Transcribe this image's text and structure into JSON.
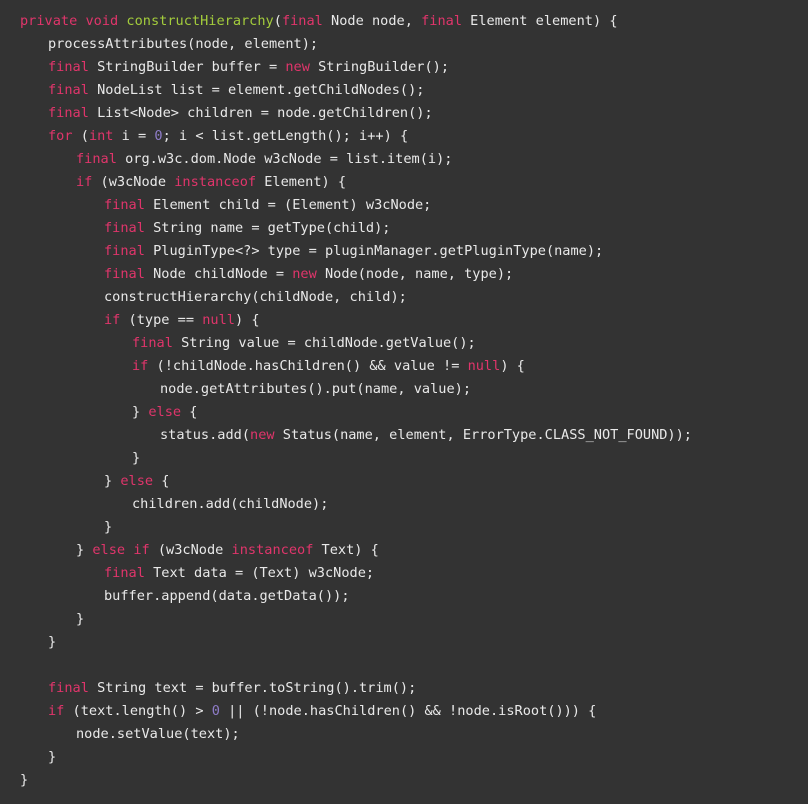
{
  "editor": {
    "background_color": "#333333",
    "default_text_color": "#e9e9e9",
    "keyword_color": "#e0356b",
    "method_color": "#a3cc3c",
    "number_color": "#8e7cc8",
    "language": "java",
    "font_size_px": 13.6,
    "line_height_px": 23
  },
  "code": {
    "lines": [
      {
        "indent": 0,
        "tokens": [
          {
            "t": "private",
            "c": "kw"
          },
          {
            "t": " ",
            "c": "pln"
          },
          {
            "t": "void",
            "c": "kw"
          },
          {
            "t": " ",
            "c": "pln"
          },
          {
            "t": "constructHierarchy",
            "c": "fn"
          },
          {
            "t": "(",
            "c": "pln"
          },
          {
            "t": "final",
            "c": "kw"
          },
          {
            "t": " Node node, ",
            "c": "pln"
          },
          {
            "t": "final",
            "c": "kw"
          },
          {
            "t": " Element element) {",
            "c": "pln"
          }
        ]
      },
      {
        "indent": 1,
        "tokens": [
          {
            "t": "processAttributes(node, element);",
            "c": "pln"
          }
        ]
      },
      {
        "indent": 1,
        "tokens": [
          {
            "t": "final",
            "c": "kw"
          },
          {
            "t": " StringBuilder buffer = ",
            "c": "pln"
          },
          {
            "t": "new",
            "c": "kw"
          },
          {
            "t": " StringBuilder();",
            "c": "pln"
          }
        ]
      },
      {
        "indent": 1,
        "tokens": [
          {
            "t": "final",
            "c": "kw"
          },
          {
            "t": " NodeList list = element.getChildNodes();",
            "c": "pln"
          }
        ]
      },
      {
        "indent": 1,
        "tokens": [
          {
            "t": "final",
            "c": "kw"
          },
          {
            "t": " List<Node> children = node.getChildren();",
            "c": "pln"
          }
        ]
      },
      {
        "indent": 1,
        "tokens": [
          {
            "t": "for",
            "c": "kw"
          },
          {
            "t": " (",
            "c": "pln"
          },
          {
            "t": "int",
            "c": "kw"
          },
          {
            "t": " i = ",
            "c": "pln"
          },
          {
            "t": "0",
            "c": "num"
          },
          {
            "t": "; i < list.getLength(); i++) {",
            "c": "pln"
          }
        ]
      },
      {
        "indent": 2,
        "tokens": [
          {
            "t": "final",
            "c": "kw"
          },
          {
            "t": " org.w3c.dom.Node w3cNode = list.item(i);",
            "c": "pln"
          }
        ]
      },
      {
        "indent": 2,
        "tokens": [
          {
            "t": "if",
            "c": "kw"
          },
          {
            "t": " (w3cNode ",
            "c": "pln"
          },
          {
            "t": "instanceof",
            "c": "kw"
          },
          {
            "t": " Element) {",
            "c": "pln"
          }
        ]
      },
      {
        "indent": 3,
        "tokens": [
          {
            "t": "final",
            "c": "kw"
          },
          {
            "t": " Element child = (Element) w3cNode;",
            "c": "pln"
          }
        ]
      },
      {
        "indent": 3,
        "tokens": [
          {
            "t": "final",
            "c": "kw"
          },
          {
            "t": " String name = getType(child);",
            "c": "pln"
          }
        ]
      },
      {
        "indent": 3,
        "tokens": [
          {
            "t": "final",
            "c": "kw"
          },
          {
            "t": " PluginType<?> type = pluginManager.getPluginType(name);",
            "c": "pln"
          }
        ]
      },
      {
        "indent": 3,
        "tokens": [
          {
            "t": "final",
            "c": "kw"
          },
          {
            "t": " Node childNode = ",
            "c": "pln"
          },
          {
            "t": "new",
            "c": "kw"
          },
          {
            "t": " Node(node, name, type);",
            "c": "pln"
          }
        ]
      },
      {
        "indent": 3,
        "tokens": [
          {
            "t": "constructHierarchy(childNode, child);",
            "c": "pln"
          }
        ]
      },
      {
        "indent": 3,
        "tokens": [
          {
            "t": "if",
            "c": "kw"
          },
          {
            "t": " (type == ",
            "c": "pln"
          },
          {
            "t": "null",
            "c": "kw"
          },
          {
            "t": ") {",
            "c": "pln"
          }
        ]
      },
      {
        "indent": 4,
        "tokens": [
          {
            "t": "final",
            "c": "kw"
          },
          {
            "t": " String value = childNode.getValue();",
            "c": "pln"
          }
        ]
      },
      {
        "indent": 4,
        "tokens": [
          {
            "t": "if",
            "c": "kw"
          },
          {
            "t": " (!childNode.hasChildren() && value != ",
            "c": "pln"
          },
          {
            "t": "null",
            "c": "kw"
          },
          {
            "t": ") {",
            "c": "pln"
          }
        ]
      },
      {
        "indent": 5,
        "tokens": [
          {
            "t": "node.getAttributes().put(name, value);",
            "c": "pln"
          }
        ]
      },
      {
        "indent": 4,
        "tokens": [
          {
            "t": "} ",
            "c": "pln"
          },
          {
            "t": "else",
            "c": "kw"
          },
          {
            "t": " {",
            "c": "pln"
          }
        ]
      },
      {
        "indent": 5,
        "tokens": [
          {
            "t": "status.add(",
            "c": "pln"
          },
          {
            "t": "new",
            "c": "kw"
          },
          {
            "t": " Status(name, element, ErrorType.CLASS_NOT_FOUND));",
            "c": "pln"
          }
        ]
      },
      {
        "indent": 4,
        "tokens": [
          {
            "t": "}",
            "c": "pln"
          }
        ]
      },
      {
        "indent": 3,
        "tokens": [
          {
            "t": "} ",
            "c": "pln"
          },
          {
            "t": "else",
            "c": "kw"
          },
          {
            "t": " {",
            "c": "pln"
          }
        ]
      },
      {
        "indent": 4,
        "tokens": [
          {
            "t": "children.add(childNode);",
            "c": "pln"
          }
        ]
      },
      {
        "indent": 3,
        "tokens": [
          {
            "t": "}",
            "c": "pln"
          }
        ]
      },
      {
        "indent": 2,
        "tokens": [
          {
            "t": "} ",
            "c": "pln"
          },
          {
            "t": "else",
            "c": "kw"
          },
          {
            "t": " ",
            "c": "pln"
          },
          {
            "t": "if",
            "c": "kw"
          },
          {
            "t": " (w3cNode ",
            "c": "pln"
          },
          {
            "t": "instanceof",
            "c": "kw"
          },
          {
            "t": " Text) {",
            "c": "pln"
          }
        ]
      },
      {
        "indent": 3,
        "tokens": [
          {
            "t": "final",
            "c": "kw"
          },
          {
            "t": " Text data = (Text) w3cNode;",
            "c": "pln"
          }
        ]
      },
      {
        "indent": 3,
        "tokens": [
          {
            "t": "buffer.append(data.getData());",
            "c": "pln"
          }
        ]
      },
      {
        "indent": 2,
        "tokens": [
          {
            "t": "}",
            "c": "pln"
          }
        ]
      },
      {
        "indent": 1,
        "tokens": [
          {
            "t": "}",
            "c": "pln"
          }
        ]
      },
      {
        "indent": 0,
        "tokens": []
      },
      {
        "indent": 1,
        "tokens": [
          {
            "t": "final",
            "c": "kw"
          },
          {
            "t": " String text = buffer.toString().trim();",
            "c": "pln"
          }
        ]
      },
      {
        "indent": 1,
        "tokens": [
          {
            "t": "if",
            "c": "kw"
          },
          {
            "t": " (text.length() > ",
            "c": "pln"
          },
          {
            "t": "0",
            "c": "num"
          },
          {
            "t": " || (!node.hasChildren() && !node.isRoot())) {",
            "c": "pln"
          }
        ]
      },
      {
        "indent": 2,
        "tokens": [
          {
            "t": "node.setValue(text);",
            "c": "pln"
          }
        ]
      },
      {
        "indent": 1,
        "tokens": [
          {
            "t": "}",
            "c": "pln"
          }
        ]
      },
      {
        "indent": 0,
        "tokens": [
          {
            "t": "}",
            "c": "pln"
          }
        ]
      }
    ]
  }
}
